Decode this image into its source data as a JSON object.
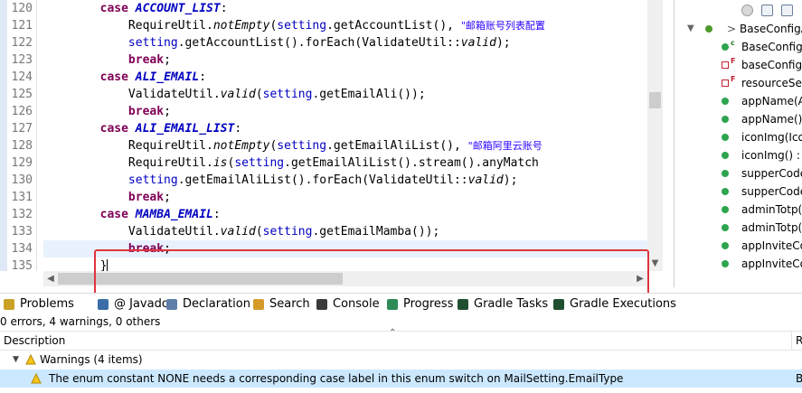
{
  "editor": {
    "line_numbers": [
      "120",
      "121",
      "122",
      "123",
      "124",
      "125",
      "126",
      "127",
      "128",
      "129",
      "130",
      "131",
      "132",
      "133",
      "134",
      "135"
    ],
    "lines": [
      [
        {
          "t": "        "
        },
        {
          "c": "kw",
          "t": "case "
        },
        {
          "c": "const",
          "t": "ACCOUNT_LIST"
        },
        {
          "t": ":"
        }
      ],
      [
        {
          "t": "            RequireUtil."
        },
        {
          "c": "ital",
          "t": "notEmpty"
        },
        {
          "t": "("
        },
        {
          "c": "fld",
          "t": "setting"
        },
        {
          "t": ".getAccountList(), "
        },
        {
          "c": "str",
          "t": "\"邮箱账号列表配置"
        }
      ],
      [
        {
          "t": "            "
        },
        {
          "c": "fld",
          "t": "setting"
        },
        {
          "t": ".getAccountList().forEach(ValidateUtil::"
        },
        {
          "c": "ital",
          "t": "valid"
        },
        {
          "t": ");"
        }
      ],
      [
        {
          "t": "            "
        },
        {
          "c": "kw",
          "t": "break"
        },
        {
          "t": ";"
        }
      ],
      [
        {
          "t": "        "
        },
        {
          "c": "kw",
          "t": "case "
        },
        {
          "c": "const",
          "t": "ALI_EMAIL"
        },
        {
          "t": ":"
        }
      ],
      [
        {
          "t": "            ValidateUtil."
        },
        {
          "c": "ital",
          "t": "valid"
        },
        {
          "t": "("
        },
        {
          "c": "fld",
          "t": "setting"
        },
        {
          "t": ".getEmailAli());"
        }
      ],
      [
        {
          "t": "            "
        },
        {
          "c": "kw",
          "t": "break"
        },
        {
          "t": ";"
        }
      ],
      [
        {
          "t": "        "
        },
        {
          "c": "kw",
          "t": "case "
        },
        {
          "c": "const",
          "t": "ALI_EMAIL_LIST"
        },
        {
          "t": ":"
        }
      ],
      [
        {
          "t": "            RequireUtil."
        },
        {
          "c": "ital",
          "t": "notEmpty"
        },
        {
          "t": "("
        },
        {
          "c": "fld",
          "t": "setting"
        },
        {
          "t": ".getEmailAliList(), "
        },
        {
          "c": "str",
          "t": "\"邮箱阿里云账号"
        }
      ],
      [
        {
          "t": "            RequireUtil."
        },
        {
          "c": "ital",
          "t": "is"
        },
        {
          "t": "("
        },
        {
          "c": "fld",
          "t": "setting"
        },
        {
          "t": ".getEmailAliList().stream().anyMatch"
        }
      ],
      [
        {
          "t": "            "
        },
        {
          "c": "fld",
          "t": "setting"
        },
        {
          "t": ".getEmailAliList().forEach(ValidateUtil::"
        },
        {
          "c": "ital",
          "t": "valid"
        },
        {
          "t": ");"
        }
      ],
      [
        {
          "t": "            "
        },
        {
          "c": "kw",
          "t": "break"
        },
        {
          "t": ";"
        }
      ],
      [
        {
          "t": "        "
        },
        {
          "c": "kw",
          "t": "case "
        },
        {
          "c": "const",
          "t": "MAMBA_EMAIL"
        },
        {
          "t": ":"
        }
      ],
      [
        {
          "t": "            ValidateUtil."
        },
        {
          "c": "ital",
          "t": "valid"
        },
        {
          "t": "("
        },
        {
          "c": "fld",
          "t": "setting"
        },
        {
          "t": ".getEmailMamba());"
        }
      ],
      [
        {
          "t": "            "
        },
        {
          "c": "kw",
          "t": "break"
        },
        {
          "t": ";"
        }
      ],
      [
        {
          "t": "        }"
        }
      ]
    ],
    "current_line_index": 14
  },
  "outline": {
    "root_label": "BaseConfigA",
    "items": [
      {
        "label": "BaseConfig",
        "kind": "constructor"
      },
      {
        "label": "baseConfigS",
        "kind": "field-private"
      },
      {
        "label": "resourceSer",
        "kind": "field-private"
      },
      {
        "label": "appName(A",
        "kind": "method"
      },
      {
        "label": "appName()",
        "kind": "method"
      },
      {
        "label": "iconImg(Ico",
        "kind": "method"
      },
      {
        "label": "iconImg() : l",
        "kind": "method"
      },
      {
        "label": "supperCode",
        "kind": "method"
      },
      {
        "label": "supperCode",
        "kind": "method"
      },
      {
        "label": "adminTotp(",
        "kind": "method"
      },
      {
        "label": "adminTotp(",
        "kind": "method"
      },
      {
        "label": "appInviteCo",
        "kind": "method"
      },
      {
        "label": "appInviteCo",
        "kind": "method"
      }
    ]
  },
  "tabs": [
    {
      "label": "Problems",
      "icon": "problems-icon",
      "active": true
    },
    {
      "label": "@ Javadoc",
      "icon": "javadoc-icon",
      "active": false
    },
    {
      "label": "Declaration",
      "icon": "declaration-icon",
      "active": false
    },
    {
      "label": "Search",
      "icon": "search-icon",
      "active": false
    },
    {
      "label": "Console",
      "icon": "console-icon",
      "active": false
    },
    {
      "label": "Progress",
      "icon": "progress-icon",
      "active": false
    },
    {
      "label": "Gradle Tasks",
      "icon": "gradle-icon",
      "active": false
    },
    {
      "label": "Gradle Executions",
      "icon": "gradle-icon",
      "active": false
    }
  ],
  "problems": {
    "summary": "0 errors, 4 warnings, 0 others",
    "col_description": "Description",
    "col_resource": "R",
    "warnings_group": "Warnings (4 items)",
    "selected_row": "The enum constant NONE needs a corresponding case label in this enum switch on MailSetting.EmailType",
    "selected_row_resource": "B"
  },
  "colors": {
    "keyword": "#7f0055",
    "constant": "#0000c0",
    "string": "#2a00ff",
    "highlight_box": "#e0333f",
    "selection": "#cce8ff"
  }
}
